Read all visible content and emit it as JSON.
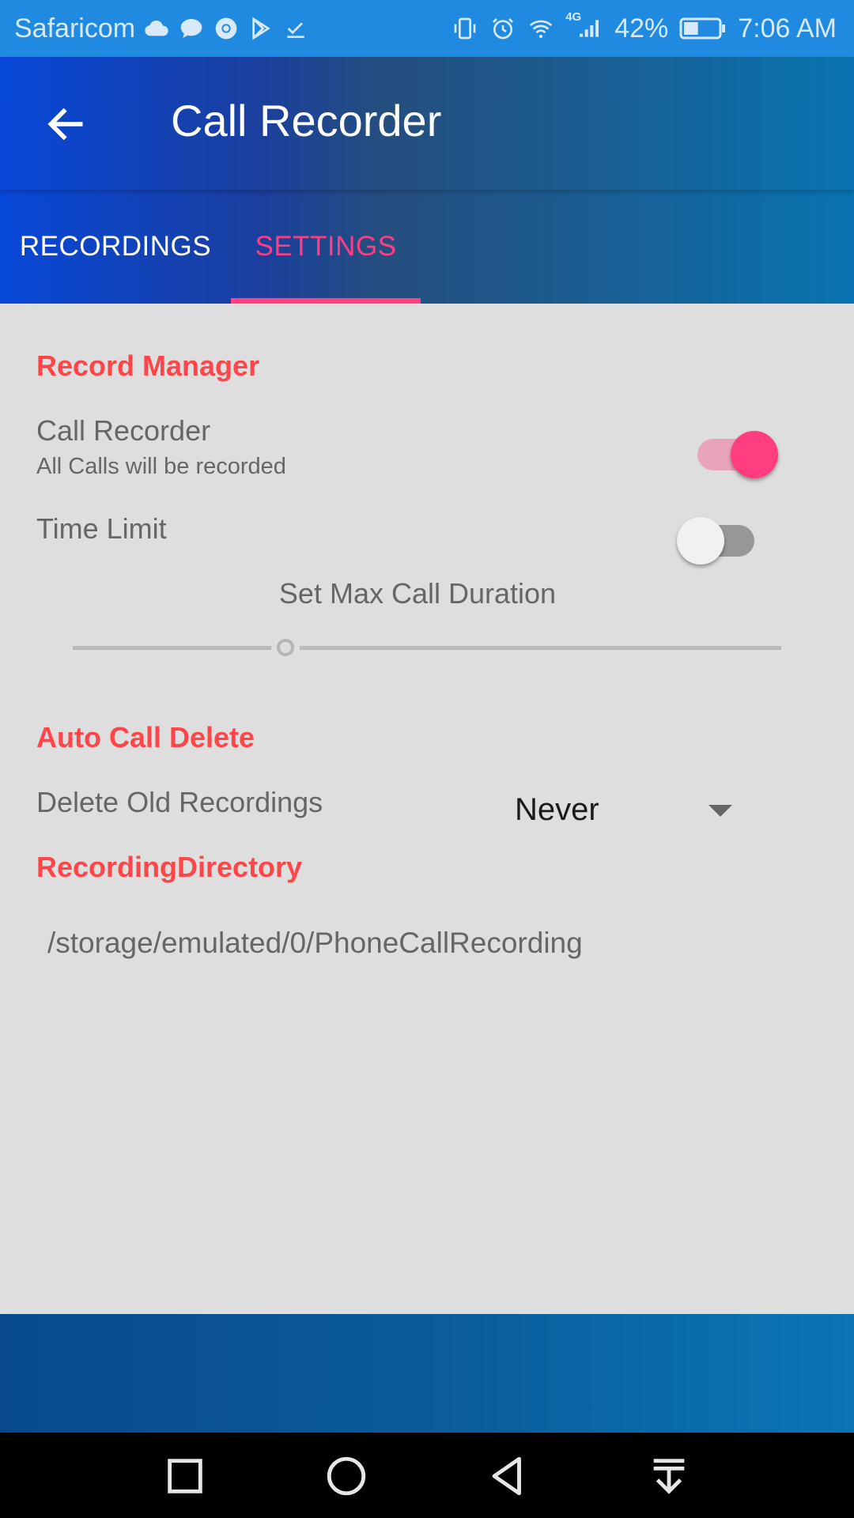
{
  "status_bar": {
    "carrier": "Safaricom",
    "left_icons": [
      "cloud-icon",
      "chat-bubble-icon",
      "chrome-icon",
      "play-store-icon",
      "download-done-icon"
    ],
    "right_icons": [
      "vibrate-icon",
      "alarm-icon",
      "wifi-icon",
      "signal-4g-icon"
    ],
    "network_label": "4G",
    "battery": "42%",
    "battery_level": 0.42,
    "time": "7:06 AM"
  },
  "app_bar": {
    "title": "Call Recorder",
    "back_icon": "arrow-back-icon"
  },
  "tabs": [
    {
      "label": "RECORDINGS",
      "selected": false
    },
    {
      "label": "SETTINGS",
      "selected": true
    }
  ],
  "settings": {
    "record_manager": {
      "title": "Record Manager",
      "call_recorder": {
        "label": "Call Recorder",
        "summary": "All Calls will be recorded",
        "enabled": true
      },
      "time_limit": {
        "label": "Time Limit",
        "enabled": false
      },
      "max_duration": {
        "label": "Set Max Call Duration",
        "value_fraction": 0.3
      }
    },
    "auto_delete": {
      "title": "Auto Call Delete",
      "delete_old": {
        "label": "Delete Old Recordings",
        "selected": "Never"
      }
    },
    "directory": {
      "title": "RecordingDirectory",
      "path": "/storage/emulated/0/PhoneCallRecording"
    }
  },
  "nav_bar": {
    "icons": [
      "recents-square-icon",
      "home-circle-icon",
      "back-triangle-icon",
      "notification-pull-icon"
    ]
  },
  "colors": {
    "accent": "#ff4081",
    "section_title": "#ff4548",
    "status_bar": "#1f8ae0",
    "content_background": "#dedede"
  }
}
